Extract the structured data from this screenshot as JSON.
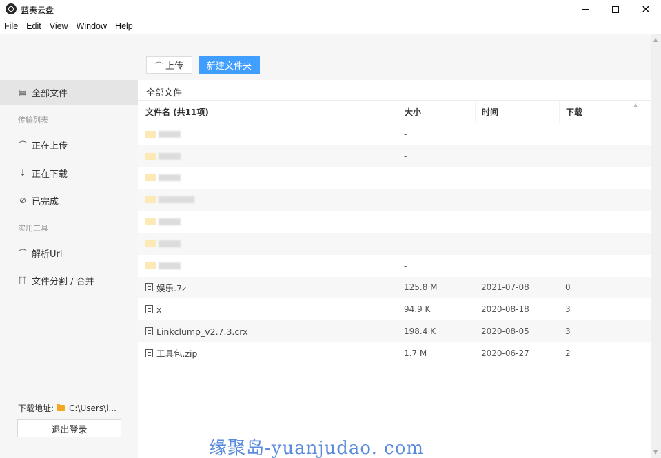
{
  "window": {
    "title": "蓝奏云盘",
    "controls": {
      "minimize": "–",
      "maximize": "☐",
      "close": "✕"
    }
  },
  "menu": [
    "File",
    "Edit",
    "View",
    "Window",
    "Help"
  ],
  "sidebar": {
    "all_files": "全部文件",
    "transfer_heading": "传输列表",
    "uploading": "正在上传",
    "downloading": "正在下载",
    "completed": "已完成",
    "tools_heading": "实用工具",
    "parse_url": "解析Url",
    "split_merge": "文件分割 / 合并",
    "download_path_label": "下载地址:",
    "download_path": "C:\\Users\\l...",
    "logout": "退出登录"
  },
  "toolbar": {
    "upload": "上传",
    "new_folder": "新建文件夹"
  },
  "breadcrumb": "全部文件",
  "table": {
    "headers": {
      "name": "文件名 (共11项)",
      "size": "大小",
      "time": "时间",
      "downloads": "下载"
    },
    "folder_rows": [
      {
        "size": "-"
      },
      {
        "size": "-"
      },
      {
        "size": "-"
      },
      {
        "size": "-"
      },
      {
        "size": "-"
      },
      {
        "size": "-"
      },
      {
        "size": "-"
      }
    ],
    "file_rows": [
      {
        "name": "娱乐.7z",
        "size": "125.8 M",
        "time": "2021-07-08",
        "downloads": "0"
      },
      {
        "name": "x",
        "size": "94.9 K",
        "time": "2020-08-18",
        "downloads": "3"
      },
      {
        "name": "Linkclump_v2.7.3.crx",
        "size": "198.4 K",
        "time": "2020-08-05",
        "downloads": "3"
      },
      {
        "name": "工具包.zip",
        "size": "1.7 M",
        "time": "2020-06-27",
        "downloads": "2"
      }
    ]
  },
  "watermark": "缘聚岛-yuanjudao. com",
  "colors": {
    "accent": "#409eff",
    "sidebar_bg": "#f6f6f6",
    "folder": "#f5a623"
  }
}
